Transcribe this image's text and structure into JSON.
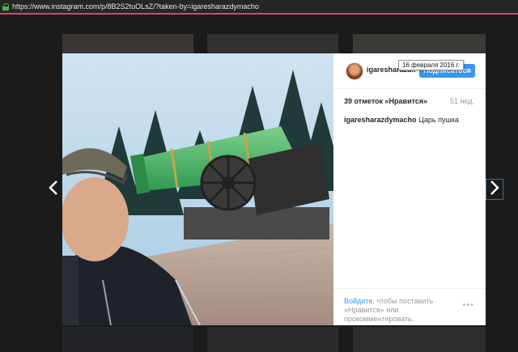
{
  "browser": {
    "url": "https://www.instagram.com/p/8B2S2tuOLsZ/?taken-by=igaresharazdymacho"
  },
  "post": {
    "username_short": "igaresharazd...",
    "follow_label": "Подписаться",
    "likes": "39 отметок «Нравится»",
    "time": "51 нед.",
    "caption_user": "igaresharazdymacho",
    "caption_text": "Царь пушка",
    "tooltip": "16 февраля 2016 г.",
    "login_link": "Войдите",
    "login_rest": ", чтобы поставить «Нравится» или прокомментировать.",
    "more": "•••"
  },
  "colors": {
    "accent": "#3897f0",
    "url_highlight": "#d0467a"
  },
  "icons": {
    "prev": "chevron-left-icon",
    "next": "chevron-right-icon",
    "lock": "lock-icon"
  }
}
